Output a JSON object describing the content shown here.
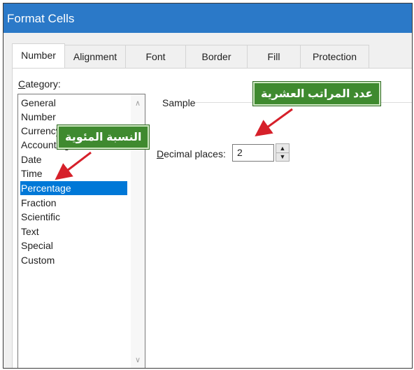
{
  "window": {
    "title": "Format Cells"
  },
  "tabs": [
    {
      "label": "Number"
    },
    {
      "label": "Alignment"
    },
    {
      "label": "Font"
    },
    {
      "label": "Border"
    },
    {
      "label": "Fill"
    },
    {
      "label": "Protection"
    }
  ],
  "category": {
    "label_prefix": "",
    "label_underlined": "C",
    "label_rest": "ategory:",
    "items": [
      {
        "label": "General"
      },
      {
        "label": "Number"
      },
      {
        "label": "Currency"
      },
      {
        "label": "Accounting"
      },
      {
        "label": "Date"
      },
      {
        "label": "Time"
      },
      {
        "label": "Percentage"
      },
      {
        "label": "Fraction"
      },
      {
        "label": "Scientific"
      },
      {
        "label": "Text"
      },
      {
        "label": "Special"
      },
      {
        "label": "Custom"
      }
    ],
    "selected": "Percentage"
  },
  "sample": {
    "label": "Sample"
  },
  "decimal": {
    "label_underlined": "D",
    "label_rest": "ecimal places:",
    "value": "2"
  },
  "annotations": {
    "decimal_callout": "عدد المراتب العشرية",
    "percentage_callout": "النسبة المئوية"
  },
  "colors": {
    "titlebar": "#2b79c8",
    "selection": "#0078d7",
    "callout_bg": "#3f8a2f",
    "arrow": "#d6202a"
  }
}
